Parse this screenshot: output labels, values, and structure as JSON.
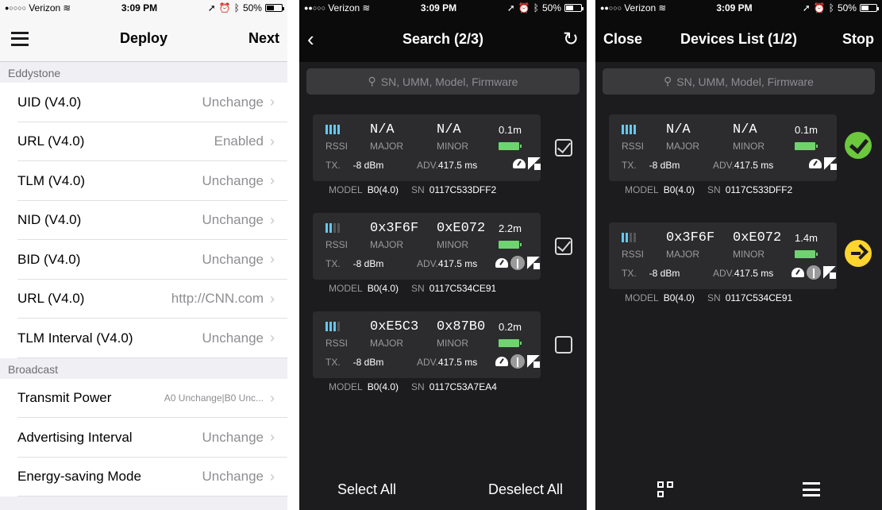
{
  "status_bar": {
    "carrier": "Verizon",
    "time": "3:09 PM",
    "battery": "50%"
  },
  "screen1": {
    "nav": {
      "title": "Deploy",
      "right": "Next"
    },
    "sections": [
      {
        "header": "Eddystone",
        "rows": [
          {
            "label": "UID (V4.0)",
            "value": "Unchange"
          },
          {
            "label": "URL (V4.0)",
            "value": "Enabled"
          },
          {
            "label": "TLM (V4.0)",
            "value": "Unchange"
          },
          {
            "label": "NID (V4.0)",
            "value": "Unchange"
          },
          {
            "label": "BID (V4.0)",
            "value": "Unchange"
          },
          {
            "label": "URL (V4.0)",
            "value": "http://CNN.com"
          },
          {
            "label": "TLM Interval (V4.0)",
            "value": "Unchange"
          }
        ]
      },
      {
        "header": "Broadcast",
        "rows": [
          {
            "label": "Transmit Power",
            "value": "A0 Unchange|B0 Unc..."
          },
          {
            "label": "Advertising Interval",
            "value": "Unchange"
          },
          {
            "label": "Energy-saving Mode",
            "value": "Unchange"
          }
        ]
      }
    ]
  },
  "screen2": {
    "nav": {
      "title": "Search (2/3)"
    },
    "search_placeholder": "SN, UMM, Model, Firmware",
    "bottom": {
      "left": "Select All",
      "right": "Deselect All"
    }
  },
  "screen3": {
    "nav": {
      "left": "Close",
      "title": "Devices List (1/2)",
      "right": "Stop"
    },
    "search_placeholder": "SN, UMM, Model, Firmware"
  },
  "labels": {
    "rssi": "RSSI",
    "major": "MAJOR",
    "minor": "MINOR",
    "tx": "TX.",
    "adv": "ADV.",
    "model": "MODEL",
    "sn": "SN"
  },
  "devices_search": [
    {
      "major": "N/A",
      "minor": "N/A",
      "distance": "0.1m",
      "tx": "-8 dBm",
      "adv": "417.5 ms",
      "model": "B0(4.0)",
      "sn": "0117C533DFF2",
      "rssi_bars": 4,
      "checked": true,
      "antenna": false
    },
    {
      "major": "0x3F6F",
      "minor": "0xE072",
      "distance": "2.2m",
      "tx": "-8 dBm",
      "adv": "417.5 ms",
      "model": "B0(4.0)",
      "sn": "0117C534CE91",
      "rssi_bars": 2,
      "checked": true,
      "antenna": true
    },
    {
      "major": "0xE5C3",
      "minor": "0x87B0",
      "distance": "0.2m",
      "tx": "-8 dBm",
      "adv": "417.5 ms",
      "model": "B0(4.0)",
      "sn": "0117C53A7EA4",
      "rssi_bars": 3,
      "checked": false,
      "antenna": true
    }
  ],
  "devices_list": [
    {
      "major": "N/A",
      "minor": "N/A",
      "distance": "0.1m",
      "tx": "-8 dBm",
      "adv": "417.5 ms",
      "model": "B0(4.0)",
      "sn": "0117C533DFF2",
      "rssi_bars": 4,
      "status": "done",
      "antenna": false
    },
    {
      "major": "0x3F6F",
      "minor": "0xE072",
      "distance": "1.4m",
      "tx": "-8 dBm",
      "adv": "417.5 ms",
      "model": "B0(4.0)",
      "sn": "0117C534CE91",
      "rssi_bars": 2,
      "status": "next",
      "antenna": true
    }
  ],
  "colors": {
    "accent_signal": "#64c8f0",
    "battery_green": "#6fd36f",
    "success": "#6cc83c",
    "pending": "#ffd52e"
  }
}
